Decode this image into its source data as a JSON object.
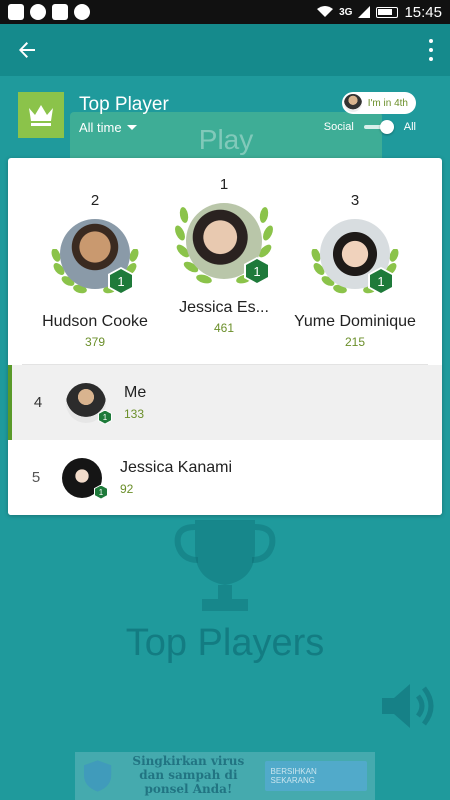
{
  "status_bar": {
    "network": "3G",
    "time": "15:45",
    "icons": [
      "plus-box-icon",
      "messenger-icon",
      "image-icon",
      "line-icon",
      "wifi-icon",
      "signal-icon",
      "battery-icon"
    ]
  },
  "app_bar": {
    "back_icon": "arrow-left-icon",
    "menu_icon": "more-vertical-icon"
  },
  "background": {
    "play_label": "Play",
    "top_players_label": "Top Players",
    "ad_text": "Singkirkan virus dan sampah di ponsel Anda!",
    "ad_button": "BERSIHKAN SEKARANG"
  },
  "leaderboard": {
    "title": "Top Player",
    "filter": "All time",
    "my_rank_pill": "I'm in 4th",
    "toggle_left": "Social",
    "toggle_right": "All",
    "toggle_state": "All",
    "accent_color": "#8bc34a",
    "badge_color": "#1e7a3a",
    "score_color": "#6b8f2a",
    "podium": [
      {
        "place": "2",
        "name": "Hudson Cooke",
        "score": "379",
        "badge": "1"
      },
      {
        "place": "1",
        "name": "Jessica Es...",
        "score": "461",
        "badge": "1"
      },
      {
        "place": "3",
        "name": "Yume Dominique",
        "score": "215",
        "badge": "1"
      }
    ],
    "rows": [
      {
        "rank": "4",
        "name": "Me",
        "score": "133",
        "badge": "1",
        "highlighted": true
      },
      {
        "rank": "5",
        "name": "Jessica Kanami",
        "score": "92",
        "badge": "1",
        "highlighted": false
      }
    ]
  }
}
